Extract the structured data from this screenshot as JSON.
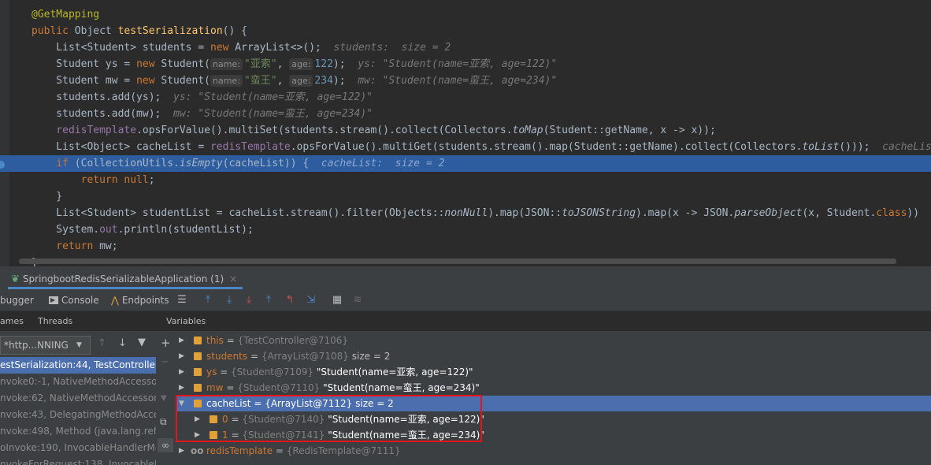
{
  "editor": {
    "lines": [
      {
        "segs": [
          [
            "ann",
            "@GetMapping"
          ]
        ]
      },
      {
        "segs": [
          [
            "kw",
            "public "
          ],
          [
            "",
            "Object "
          ],
          [
            "fn",
            "testSerialization"
          ],
          [
            "",
            "() {"
          ]
        ]
      },
      {
        "segs": [
          [
            "",
            "    List<Student> students = "
          ],
          [
            "kw",
            "new "
          ],
          [
            "",
            "ArrayList<>();"
          ],
          [
            "hint",
            "  students:  size = 2"
          ]
        ]
      },
      {
        "segs": [
          [
            "",
            "    Student ys = "
          ],
          [
            "kw",
            "new "
          ],
          [
            "",
            "Student("
          ],
          [
            "param",
            "name:"
          ],
          [
            "str",
            "\"亚索\""
          ],
          [
            "",
            ", "
          ],
          [
            "param",
            "age:"
          ],
          [
            "num",
            "122"
          ],
          [
            "",
            ");"
          ],
          [
            "hint",
            "  ys: \"Student(name=亚索, age=122)\""
          ]
        ]
      },
      {
        "segs": [
          [
            "",
            "    Student mw = "
          ],
          [
            "kw",
            "new "
          ],
          [
            "",
            "Student("
          ],
          [
            "param",
            "name:"
          ],
          [
            "str",
            "\"蛮王\""
          ],
          [
            "",
            ", "
          ],
          [
            "param",
            "age:"
          ],
          [
            "num",
            "234"
          ],
          [
            "",
            ");"
          ],
          [
            "hint",
            "  mw: \"Student(name=蛮王, age=234)\""
          ]
        ]
      },
      {
        "segs": [
          [
            "",
            "    students.add(ys);"
          ],
          [
            "hint",
            "  ys: \"Student(name=亚索, age=122)\""
          ]
        ]
      },
      {
        "segs": [
          [
            "",
            "    students.add(mw);"
          ],
          [
            "hint",
            "  mw: \"Student(name=蛮王, age=234)\""
          ]
        ]
      },
      {
        "segs": [
          [
            "fld",
            "    redisTemplate"
          ],
          [
            "",
            ".opsForValue().multiSet(students.stream().collect(Collectors."
          ],
          [
            "it",
            "toMap"
          ],
          [
            "",
            "(Student::getName, x -> x));"
          ]
        ]
      },
      {
        "segs": [
          [
            "",
            "    List<Object> cacheList = "
          ],
          [
            "fld",
            "redisTemplate"
          ],
          [
            "",
            ".opsForValue().multiGet(students.stream().map(Student::getName).collect(Collectors."
          ],
          [
            "it",
            "toList"
          ],
          [
            "",
            "()));"
          ],
          [
            "hint",
            "  cacheList:  size = 2"
          ]
        ]
      },
      {
        "segs": [
          [
            "kw",
            "    if "
          ],
          [
            "",
            "(CollectionUtils."
          ],
          [
            "it",
            "isEmpty"
          ],
          [
            "",
            "(cacheList)) {"
          ],
          [
            "hint",
            "  cacheList:  size = 2"
          ]
        ],
        "current": true
      },
      {
        "segs": [
          [
            "kw",
            "        return null"
          ],
          [
            "",
            ";"
          ]
        ]
      },
      {
        "segs": [
          [
            "",
            "    }"
          ]
        ]
      },
      {
        "segs": [
          [
            "",
            "    List<Student> studentList = cacheList.stream().filter(Objects::"
          ],
          [
            "it",
            "nonNull"
          ],
          [
            "",
            ").map(JSON::"
          ],
          [
            "it",
            "toJSONString"
          ],
          [
            "",
            ").map(x -> JSON."
          ],
          [
            "it",
            "parseObject"
          ],
          [
            "",
            "(x, Student."
          ],
          [
            "kw",
            "class"
          ],
          [
            "",
            "))"
          ]
        ]
      },
      {
        "segs": [
          [
            "",
            "    System."
          ],
          [
            "fld",
            "out"
          ],
          [
            "",
            ".println(studentList);"
          ]
        ]
      },
      {
        "segs": [
          [
            "kw",
            "    return "
          ],
          [
            "",
            "mw;"
          ]
        ]
      }
    ],
    "closing_brace": "}"
  },
  "run_tab": {
    "label": "SpringbootRedisSerializableApplication (1)",
    "close": "×"
  },
  "toolbar": {
    "debugger": "bugger",
    "console": "Console",
    "endpoints": "Endpoints"
  },
  "subtabs": {
    "frames": "ames",
    "threads": "Threads",
    "variables": "Variables"
  },
  "thread_select": "*http...NNING",
  "frames": [
    {
      "text": "estSerialization:44, TestController",
      "selected": true
    },
    {
      "text": "nvoke0:-1, NativeMethodAccessor"
    },
    {
      "text": "nvoke:62, NativeMethodAccessorI"
    },
    {
      "text": "nvoke:43, DelegatingMethodAccess"
    },
    {
      "text": "nvoke:498, Method (java.lang.reflect)"
    },
    {
      "text": "oInvoke:190, InvocableHandlerMe"
    },
    {
      "text": "nvokeForRequest:138, InvocableHa"
    }
  ],
  "variables": [
    {
      "name": "this",
      "type": "{TestController@7106}",
      "value": "",
      "size": "",
      "expanded": false
    },
    {
      "name": "students",
      "type": "{ArrayList@7108}",
      "value": "",
      "size": "size = 2",
      "expanded": false
    },
    {
      "name": "ys",
      "type": "{Student@7109}",
      "value": "\"Student(name=亚索, age=122)\"",
      "size": "",
      "expanded": false
    },
    {
      "name": "mw",
      "type": "{Student@7110}",
      "value": "\"Student(name=蛮王, age=234)\"",
      "size": "",
      "expanded": false
    },
    {
      "name": "cacheList",
      "type": "{ArrayList@7112}",
      "value": "",
      "size": "size = 2",
      "expanded": true,
      "selected": true
    },
    {
      "name": "0",
      "type": "{Student@7140}",
      "value": "\"Student(name=亚索, age=122)\"",
      "size": "",
      "child": true
    },
    {
      "name": "1",
      "type": "{Student@7141}",
      "value": "\"Student(name=蛮王, age=234)\"",
      "size": "",
      "child": true
    },
    {
      "name": "redisTemplate",
      "type": "{RedisTemplate@7111}",
      "value": "",
      "size": "",
      "oo": true
    }
  ],
  "colors": {
    "accent": "#4b6eaf",
    "highlight_box": "#e5141b",
    "current_line": "#2d5d9e"
  }
}
